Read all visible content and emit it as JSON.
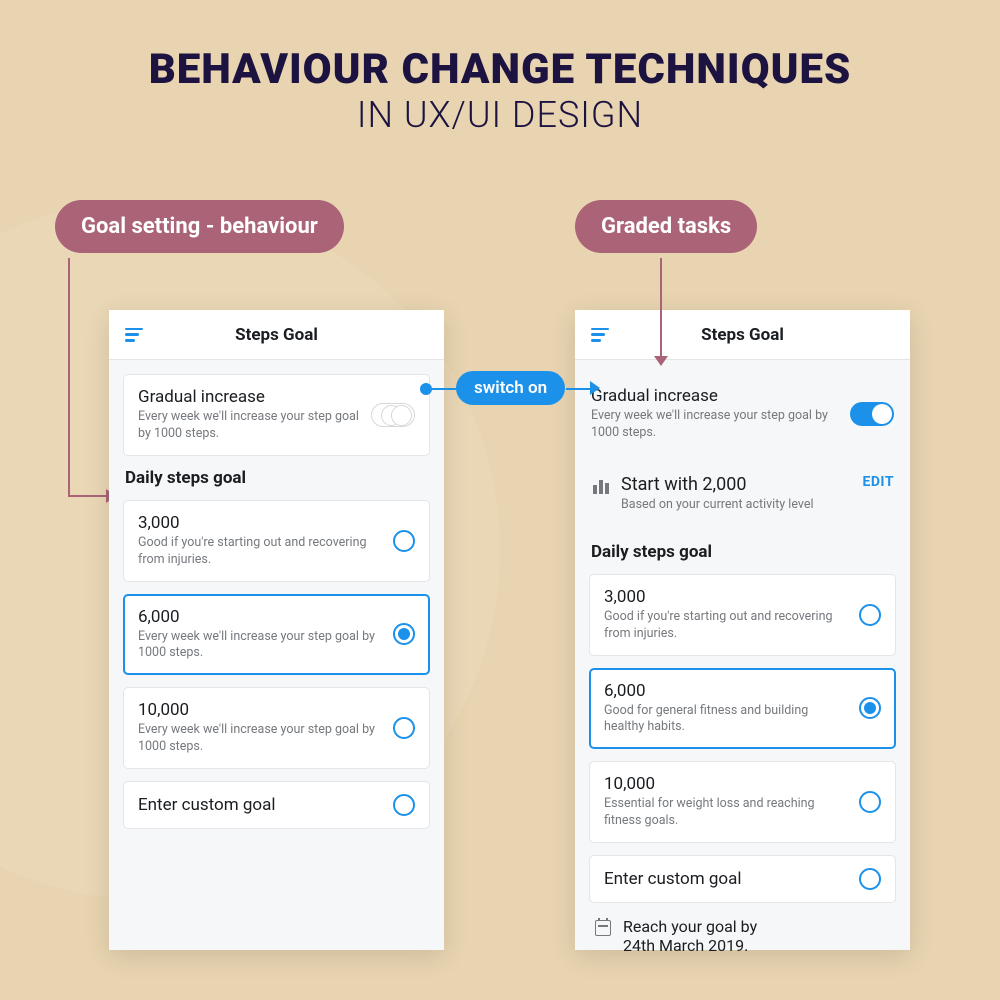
{
  "header": {
    "title_main": "BEHAVIOUR CHANGE TECHNIQUES",
    "title_sub": "IN UX/UI DESIGN"
  },
  "labels": {
    "left_pill": "Goal setting - behaviour",
    "right_pill": "Graded tasks",
    "switch_on": "switch on"
  },
  "left_screen": {
    "title": "Steps Goal",
    "gradual": {
      "title": "Gradual increase",
      "sub": "Every week we'll increase your step goal by 1000 steps."
    },
    "section": "Daily steps goal",
    "options": [
      {
        "title": "3,000",
        "sub": "Good if you're starting out and recovering from injuries.",
        "selected": false
      },
      {
        "title": "6,000",
        "sub": "Every week we'll increase your step goal by 1000 steps.",
        "selected": true
      },
      {
        "title": "10,000",
        "sub": "Every week we'll increase your step goal by 1000 steps.",
        "selected": false
      }
    ],
    "custom": "Enter custom goal"
  },
  "right_screen": {
    "title": "Steps Goal",
    "gradual": {
      "title": "Gradual increase",
      "sub": "Every week we'll increase your step goal by 1000 steps."
    },
    "start": {
      "title": "Start with 2,000",
      "sub": "Based on your current activity level",
      "edit": "EDIT"
    },
    "section": "Daily steps goal",
    "options": [
      {
        "title": "3,000",
        "sub": "Good if you're starting out and recovering from injuries.",
        "selected": false
      },
      {
        "title": "6,000",
        "sub": "Good for general fitness and building healthy habits.",
        "selected": true
      },
      {
        "title": "10,000",
        "sub": "Essential for weight loss and reaching fitness goals.",
        "selected": false
      }
    ],
    "custom": "Enter custom goal",
    "reach_line1": "Reach your goal by",
    "reach_line2": "24th March 2019."
  }
}
